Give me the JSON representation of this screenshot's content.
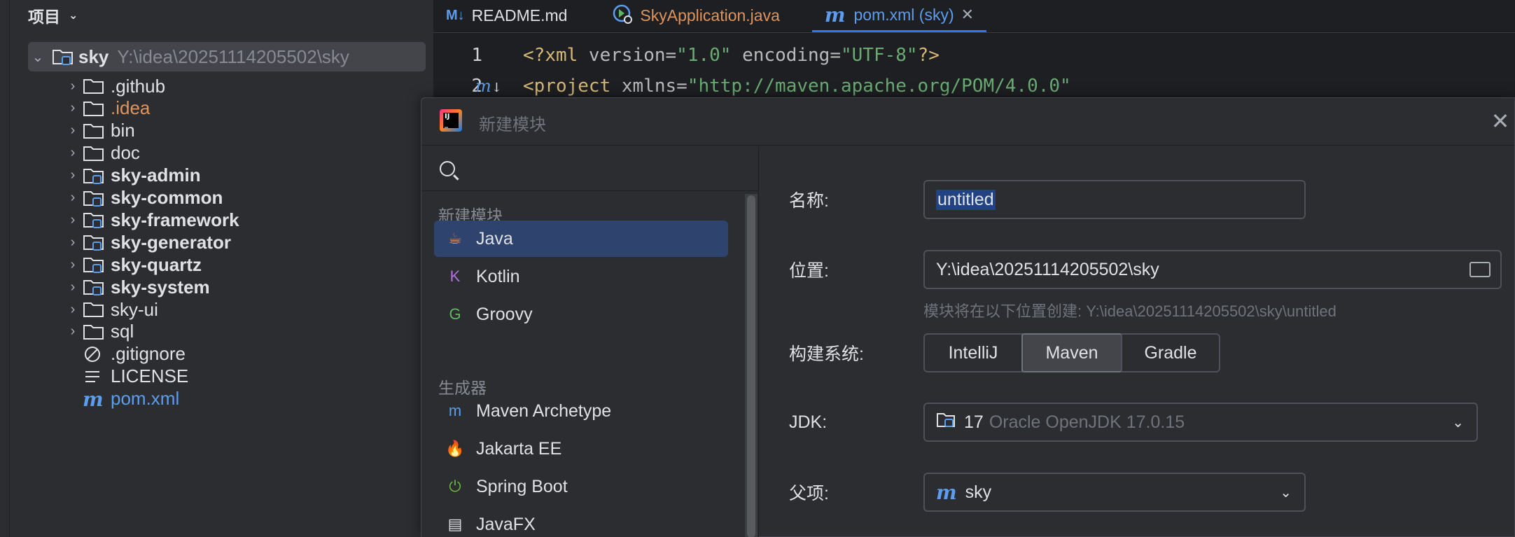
{
  "project_panel": {
    "title": "项目",
    "root": {
      "name": "sky",
      "path": "Y:\\idea\\20251114205502\\sky"
    },
    "items": [
      {
        "label": ".github",
        "bold": false,
        "color": "default",
        "expandable": true
      },
      {
        "label": ".idea",
        "bold": false,
        "color": "orange",
        "expandable": true
      },
      {
        "label": "bin",
        "bold": false,
        "color": "default",
        "expandable": true
      },
      {
        "label": "doc",
        "bold": false,
        "color": "default",
        "expandable": true
      },
      {
        "label": "sky-admin",
        "bold": true,
        "color": "default",
        "expandable": true
      },
      {
        "label": "sky-common",
        "bold": true,
        "color": "default",
        "expandable": true
      },
      {
        "label": "sky-framework",
        "bold": true,
        "color": "default",
        "expandable": true
      },
      {
        "label": "sky-generator",
        "bold": true,
        "color": "default",
        "expandable": true
      },
      {
        "label": "sky-quartz",
        "bold": true,
        "color": "default",
        "expandable": true
      },
      {
        "label": "sky-system",
        "bold": true,
        "color": "default",
        "expandable": true
      },
      {
        "label": "sky-ui",
        "bold": false,
        "color": "default",
        "expandable": true
      },
      {
        "label": "sql",
        "bold": false,
        "color": "default",
        "expandable": true
      },
      {
        "label": ".gitignore",
        "bold": false,
        "color": "default",
        "expandable": false
      },
      {
        "label": "LICENSE",
        "bold": false,
        "color": "default",
        "expandable": false
      },
      {
        "label": "pom.xml",
        "bold": false,
        "color": "blue",
        "expandable": false
      }
    ]
  },
  "editor": {
    "tabs": [
      {
        "label": "README.md",
        "icon": "M↓",
        "color": "#dfe1e5"
      },
      {
        "label": "SkyApplication.java",
        "icon": "java-run-icon",
        "color": "#e0945b"
      },
      {
        "label": "pom.xml (sky)",
        "icon": "m",
        "color": "#5c9ded",
        "active": true
      }
    ],
    "lines": [
      {
        "num": "1"
      },
      {
        "num": "2"
      }
    ],
    "code": {
      "line1_pi_open": "<?",
      "line1_xml": "xml",
      "line1_attr1": " version=",
      "line1_val1": "\"1.0\"",
      "line1_attr2": " encoding=",
      "line1_val2": "\"UTF-8\"",
      "line1_pi_close": "?>",
      "line2_tag": "<project",
      "line2_attr": " xmlns=",
      "line2_val": "\"http://maven.apache.org/POM/4.0.0\""
    }
  },
  "dialog": {
    "title": "新建模块",
    "left": {
      "section1": "新建模块",
      "section2": "生成器",
      "items1": [
        {
          "label": "Java",
          "icon": "☕",
          "icon_color": "#e0945b",
          "selected": true
        },
        {
          "label": "Kotlin",
          "icon": "K",
          "icon_color": "#b070e0"
        },
        {
          "label": "Groovy",
          "icon": "G",
          "icon_color": "#5fb85f"
        }
      ],
      "items2": [
        {
          "label": "Maven Archetype",
          "icon": "m",
          "icon_color": "#5c9ded"
        },
        {
          "label": "Jakarta EE",
          "icon": "🔥",
          "icon_color": "#f4b400"
        },
        {
          "label": "Spring Boot",
          "icon": "⏻",
          "icon_color": "#6db33f"
        },
        {
          "label": "JavaFX",
          "icon": "▤",
          "icon_color": "#dfe1e5"
        }
      ]
    },
    "form": {
      "name_label": "名称:",
      "name_value": "untitled",
      "location_label": "位置:",
      "location_value": "Y:\\idea\\20251114205502\\sky",
      "location_hint": "模块将在以下位置创建: Y:\\idea\\20251114205502\\sky\\untitled",
      "build_label": "构建系统:",
      "build_options": [
        "IntelliJ",
        "Maven",
        "Gradle"
      ],
      "build_selected": "Maven",
      "jdk_label": "JDK:",
      "jdk_version": "17",
      "jdk_name": "Oracle OpenJDK 17.0.15",
      "parent_label": "父项:",
      "parent_value": "sky"
    }
  }
}
